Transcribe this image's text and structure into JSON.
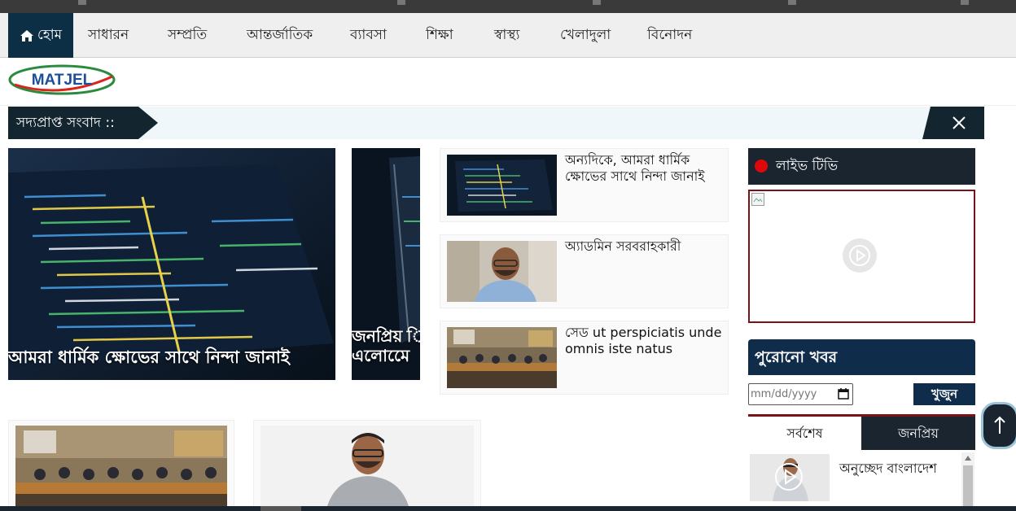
{
  "nav": {
    "home": "হোম",
    "items": [
      "সাধারন",
      "সম্প্রতি",
      "আন্তর্জাতিক",
      "ব্যাবসা",
      "শিক্ষা",
      "স্বাস্থ্য",
      "খেলাদুলা",
      "বিনোদন"
    ]
  },
  "logo": {
    "text": "MATJEL"
  },
  "breaking": {
    "label": "সদ্যপ্রাপ্ত সংবাদ ::",
    "close_icon": "close-icon"
  },
  "featured": [
    {
      "title": "আমরা ধার্মিক ক্ষোভের সাথে নিন্দা জানাই"
    },
    {
      "title_line1": "জনপ্রিয় ি",
      "title_line2": "এলোমেে"
    }
  ],
  "cards": [
    {
      "title": "অন্যদিকে, আমরা ধার্মিক ক্ষোভের সাথে নিন্দা জানাই"
    },
    {
      "title": "অ্যাডমিন সরবরাহকারী"
    },
    {
      "title": "সেড ut perspiciatis unde omnis iste natus"
    }
  ],
  "live": {
    "title": "লাইভ টিভি"
  },
  "archive": {
    "title": "পুরোনো খবর",
    "date_placeholder": "mm/dd/yyyy",
    "search_label": "খুজুন"
  },
  "tabs": {
    "latest": "সর্বশেষ",
    "popular": "জনপ্রিয়"
  },
  "latest_list": [
    {
      "title": "অনুচ্ছেদ বাংলাদেশ"
    }
  ],
  "colors": {
    "nav_active": "#0d2f45",
    "live_dot": "#e0070b",
    "accent_red": "#7a1318",
    "panel_navy": "#0f2c4a"
  }
}
